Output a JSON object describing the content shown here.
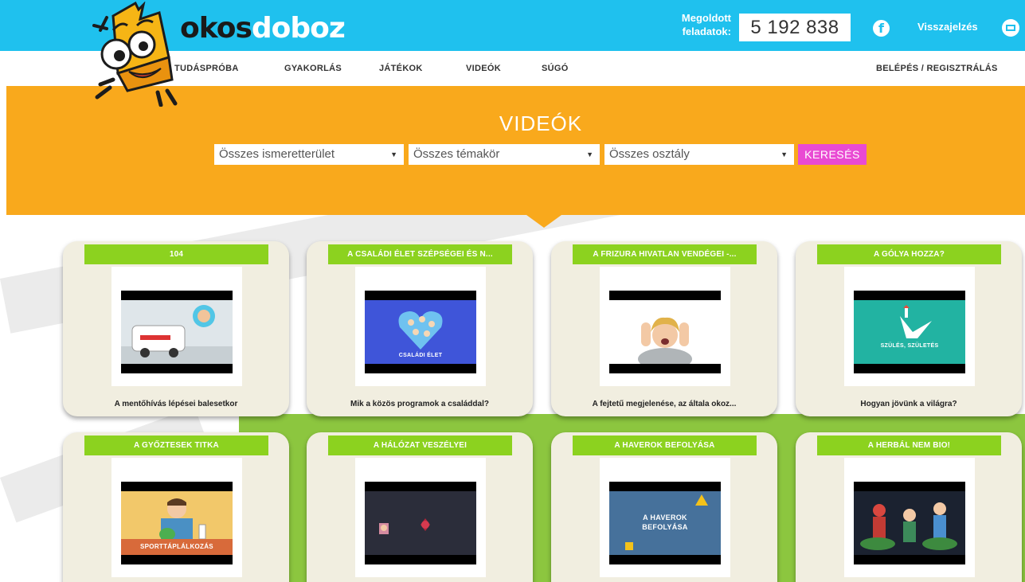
{
  "header": {
    "logo_part1": "okos",
    "logo_part2": "doboz",
    "solved_label_line1": "Megoldott",
    "solved_label_line2": "feladatok:",
    "solved_count": "5 192 838",
    "feedback_label": "Visszajelzés",
    "icons": [
      "facebook-icon",
      "mail-icon"
    ]
  },
  "nav": {
    "items": [
      "TUDÁSPRÓBA",
      "GYAKORLÁS",
      "JÁTÉKOK",
      "VIDEÓK",
      "SÚGÓ"
    ],
    "login": "BELÉPÉS / REGISZTRÁLÁS"
  },
  "hero": {
    "title": "VIDEÓK",
    "filters": [
      {
        "value": "Összes ismeretterület"
      },
      {
        "value": "Összes témakör"
      },
      {
        "value": "Összes osztály"
      }
    ],
    "search_label": "KERESÉS"
  },
  "videos": [
    {
      "title": "104",
      "description": "A mentőhívás lépései balesetkor"
    },
    {
      "title": "A CSALÁDI ÉLET SZÉPSÉGEI ÉS N...",
      "description": "Mik a közös programok a családdal?",
      "thumb_text": "CSALÁDI ÉLET"
    },
    {
      "title": "A FRIZURA HIVATLAN VENDÉGEI -...",
      "description": "A fejtetű megjelenése, az általa okoz..."
    },
    {
      "title": "A GÓLYA HOZZA?",
      "description": "Hogyan jövünk a világra?",
      "thumb_text": "SZÜLÉS, SZÜLETÉS"
    },
    {
      "title": "A GYŐZTESEK TITKA",
      "description": "",
      "thumb_text": "SPORTTÁPLÁLKOZÁS"
    },
    {
      "title": "A HÁLÓZAT VESZÉLYEI",
      "description": ""
    },
    {
      "title": "A HAVEROK BEFOLYÁSA",
      "description": "",
      "thumb_text_line1": "A HAVEROK",
      "thumb_text_line2": "BEFOLYÁSA"
    },
    {
      "title": "A HERBÁL NEM BIO!",
      "description": ""
    }
  ],
  "colors": {
    "top_bar": "#1fc1ee",
    "hero": "#f9a91c",
    "search_button": "#e94ad3",
    "card_title": "#8cd21f",
    "card_bg": "#f1eee0"
  }
}
